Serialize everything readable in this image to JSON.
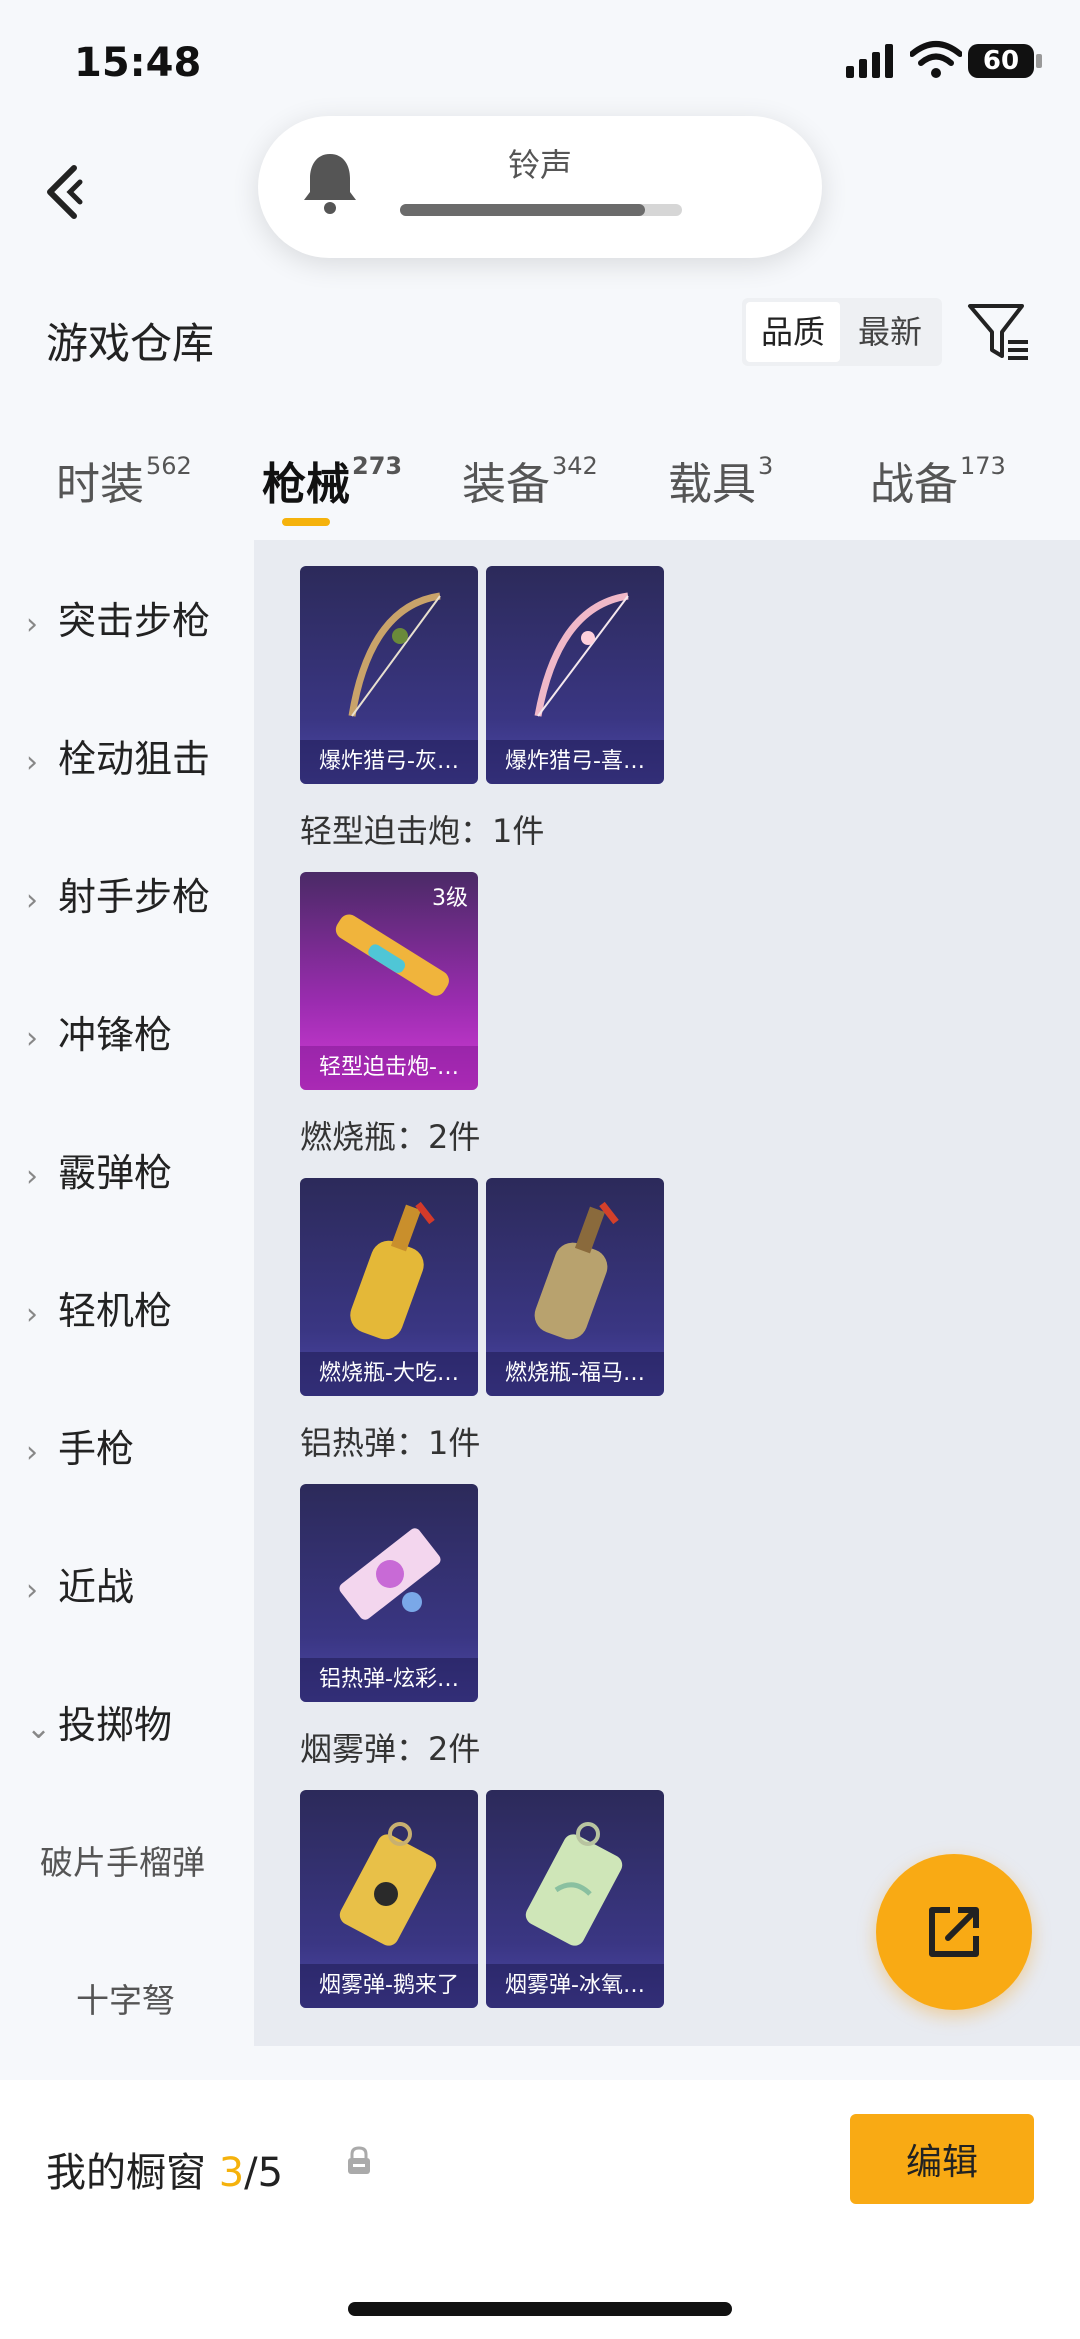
{
  "status_bar": {
    "time": "15:48",
    "battery": "60"
  },
  "ringtone": {
    "label": "铃声",
    "level": 0.87
  },
  "header": {
    "title": "游戏仓库",
    "sort_quality": "品质",
    "sort_newest": "最新"
  },
  "tabs": [
    {
      "label": "时装",
      "count": "562"
    },
    {
      "label": "枪械",
      "count": "273"
    },
    {
      "label": "装备",
      "count": "342"
    },
    {
      "label": "载具",
      "count": "3"
    },
    {
      "label": "战备",
      "count": "173"
    }
  ],
  "sidebar": {
    "items": [
      "突击步枪",
      "栓动狙击",
      "射手步枪",
      "冲锋枪",
      "霰弹枪",
      "轻机枪",
      "手枪",
      "近战",
      "投掷物"
    ],
    "subitems": [
      "破片手榴弹",
      "十字弩"
    ]
  },
  "content": {
    "top_cards": [
      "爆炸猎弓-灰…",
      "爆炸猎弓-喜…"
    ],
    "sections": [
      {
        "title": "轻型迫击炮：1件",
        "cards": [
          {
            "name": "轻型迫击炮-…",
            "level": "3级"
          }
        ]
      },
      {
        "title": "燃烧瓶：2件",
        "cards": [
          {
            "name": "燃烧瓶-大吃…"
          },
          {
            "name": "燃烧瓶-福马…"
          }
        ]
      },
      {
        "title": "铝热弹：1件",
        "cards": [
          {
            "name": "铝热弹-炫彩…"
          }
        ]
      },
      {
        "title": "烟雾弹：2件",
        "cards": [
          {
            "name": "烟雾弹-鹅来了"
          },
          {
            "name": "烟雾弹-冰氧…"
          }
        ]
      }
    ]
  },
  "bottom": {
    "title": "我的橱窗",
    "current": "3",
    "total": "/5",
    "edit_label": "编辑"
  },
  "colors": {
    "accent": "#F9AA14",
    "card_bg": "#3A3683",
    "card_pink": "#D33CD7"
  }
}
